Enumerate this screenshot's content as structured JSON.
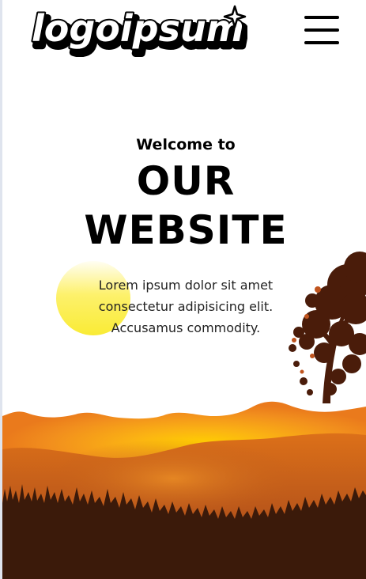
{
  "header": {
    "logo_text": "logoipsum",
    "menu_icon": "hamburger-menu-icon"
  },
  "hero": {
    "welcome": "Welcome to",
    "title_line1": "OUR",
    "title_line2": "WEBSITE",
    "body_line1": "Lorem ipsum dolor sit amet",
    "body_line2": "consectetur adipisicing elit.",
    "body_line3": "Accusamus commodity."
  },
  "colors": {
    "sun": "#f9eb35",
    "sky_orange": "#f08a1e",
    "glow": "#ffcf00",
    "hills_mid": "#d4661a",
    "ground": "#3b1a0a"
  }
}
